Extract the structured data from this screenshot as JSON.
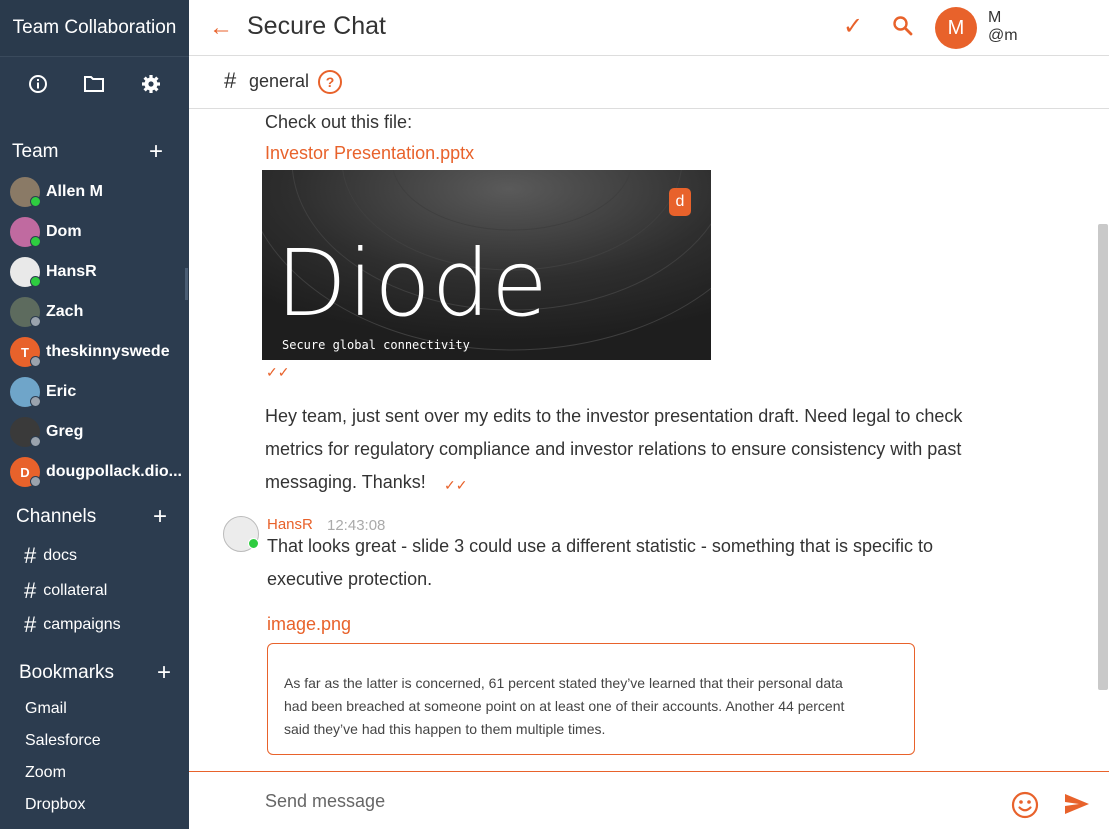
{
  "sidebar": {
    "app_title": "Team Collaboration",
    "team_label": "Team",
    "members": [
      {
        "name": "Allen M",
        "initial": "",
        "avatar_color": "#8a7a66",
        "status": "online"
      },
      {
        "name": "Dom",
        "initial": "",
        "avatar_color": "#c06aa0",
        "status": "online"
      },
      {
        "name": "HansR",
        "initial": "",
        "avatar_color": "#e9e9e9",
        "status": "online"
      },
      {
        "name": "Zach",
        "initial": "",
        "avatar_color": "#5d6b5e",
        "status": "offline"
      },
      {
        "name": "theskinnyswede",
        "initial": "T",
        "avatar_color": "#e8622b",
        "status": "offline"
      },
      {
        "name": "Eric",
        "initial": "",
        "avatar_color": "#6fa5c9",
        "status": "offline"
      },
      {
        "name": "Greg",
        "initial": "",
        "avatar_color": "#3a3a3a",
        "status": "offline"
      },
      {
        "name": "dougpollack.dio...",
        "initial": "D",
        "avatar_color": "#e8622b",
        "status": "offline"
      }
    ],
    "channels_label": "Channels",
    "channels": [
      "docs",
      "collateral",
      "campaigns"
    ],
    "bookmarks_label": "Bookmarks",
    "bookmarks": [
      "Gmail",
      "Salesforce",
      "Zoom",
      "Dropbox"
    ]
  },
  "header": {
    "title": "Secure Chat",
    "user_initial": "M",
    "user_name": "M",
    "user_handle": "@m"
  },
  "channel": {
    "hash": "#",
    "name": "general"
  },
  "messages": {
    "file_intro": "Check out this file:",
    "file_name": "Investor Presentation.pptx",
    "slide_title": "Diode",
    "slide_tagline": "Secure global connectivity",
    "body_lines": [
      "Hey team, just sent over my edits to the investor presentation draft. Need legal to check",
      "metrics for regulatory compliance and investor relations to ensure consistency with past",
      "messaging. Thanks!"
    ],
    "reply": {
      "author": "HansR",
      "time": "12:43:08",
      "lines": [
        "That looks great - slide 3 could use a different statistic - something that is specific to",
        "executive protection."
      ],
      "attachment": "image.png",
      "quote_lines": [
        "As far as the latter is concerned, 61 percent stated they’ve learned that their personal data",
        "had been breached at someone point on at least one of their accounts. Another 44 percent",
        "said they’ve had this happen to them multiple times."
      ]
    }
  },
  "composer": {
    "placeholder": "Send message"
  },
  "colors": {
    "accent": "#e8622b",
    "sidebar_bg": "#2c3c4f",
    "online": "#2ecc40",
    "offline": "#9aa3ad"
  }
}
